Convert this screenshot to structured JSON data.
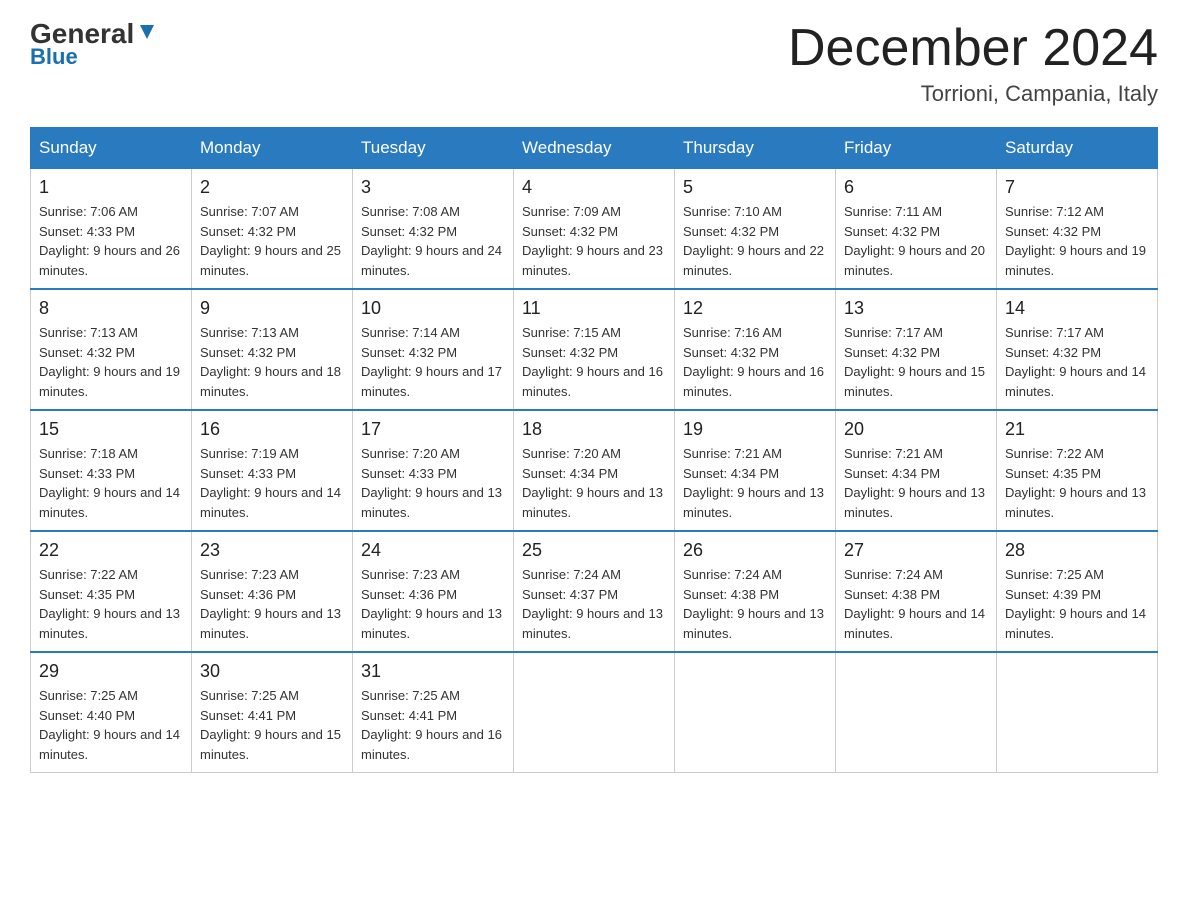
{
  "header": {
    "logo_general": "General",
    "logo_blue": "Blue",
    "month_year": "December 2024",
    "location": "Torrioni, Campania, Italy"
  },
  "days_of_week": [
    "Sunday",
    "Monday",
    "Tuesday",
    "Wednesday",
    "Thursday",
    "Friday",
    "Saturday"
  ],
  "weeks": [
    [
      {
        "day": "1",
        "sunrise": "7:06 AM",
        "sunset": "4:33 PM",
        "daylight": "9 hours and 26 minutes."
      },
      {
        "day": "2",
        "sunrise": "7:07 AM",
        "sunset": "4:32 PM",
        "daylight": "9 hours and 25 minutes."
      },
      {
        "day": "3",
        "sunrise": "7:08 AM",
        "sunset": "4:32 PM",
        "daylight": "9 hours and 24 minutes."
      },
      {
        "day": "4",
        "sunrise": "7:09 AM",
        "sunset": "4:32 PM",
        "daylight": "9 hours and 23 minutes."
      },
      {
        "day": "5",
        "sunrise": "7:10 AM",
        "sunset": "4:32 PM",
        "daylight": "9 hours and 22 minutes."
      },
      {
        "day": "6",
        "sunrise": "7:11 AM",
        "sunset": "4:32 PM",
        "daylight": "9 hours and 20 minutes."
      },
      {
        "day": "7",
        "sunrise": "7:12 AM",
        "sunset": "4:32 PM",
        "daylight": "9 hours and 19 minutes."
      }
    ],
    [
      {
        "day": "8",
        "sunrise": "7:13 AM",
        "sunset": "4:32 PM",
        "daylight": "9 hours and 19 minutes."
      },
      {
        "day": "9",
        "sunrise": "7:13 AM",
        "sunset": "4:32 PM",
        "daylight": "9 hours and 18 minutes."
      },
      {
        "day": "10",
        "sunrise": "7:14 AM",
        "sunset": "4:32 PM",
        "daylight": "9 hours and 17 minutes."
      },
      {
        "day": "11",
        "sunrise": "7:15 AM",
        "sunset": "4:32 PM",
        "daylight": "9 hours and 16 minutes."
      },
      {
        "day": "12",
        "sunrise": "7:16 AM",
        "sunset": "4:32 PM",
        "daylight": "9 hours and 16 minutes."
      },
      {
        "day": "13",
        "sunrise": "7:17 AM",
        "sunset": "4:32 PM",
        "daylight": "9 hours and 15 minutes."
      },
      {
        "day": "14",
        "sunrise": "7:17 AM",
        "sunset": "4:32 PM",
        "daylight": "9 hours and 14 minutes."
      }
    ],
    [
      {
        "day": "15",
        "sunrise": "7:18 AM",
        "sunset": "4:33 PM",
        "daylight": "9 hours and 14 minutes."
      },
      {
        "day": "16",
        "sunrise": "7:19 AM",
        "sunset": "4:33 PM",
        "daylight": "9 hours and 14 minutes."
      },
      {
        "day": "17",
        "sunrise": "7:20 AM",
        "sunset": "4:33 PM",
        "daylight": "9 hours and 13 minutes."
      },
      {
        "day": "18",
        "sunrise": "7:20 AM",
        "sunset": "4:34 PM",
        "daylight": "9 hours and 13 minutes."
      },
      {
        "day": "19",
        "sunrise": "7:21 AM",
        "sunset": "4:34 PM",
        "daylight": "9 hours and 13 minutes."
      },
      {
        "day": "20",
        "sunrise": "7:21 AM",
        "sunset": "4:34 PM",
        "daylight": "9 hours and 13 minutes."
      },
      {
        "day": "21",
        "sunrise": "7:22 AM",
        "sunset": "4:35 PM",
        "daylight": "9 hours and 13 minutes."
      }
    ],
    [
      {
        "day": "22",
        "sunrise": "7:22 AM",
        "sunset": "4:35 PM",
        "daylight": "9 hours and 13 minutes."
      },
      {
        "day": "23",
        "sunrise": "7:23 AM",
        "sunset": "4:36 PM",
        "daylight": "9 hours and 13 minutes."
      },
      {
        "day": "24",
        "sunrise": "7:23 AM",
        "sunset": "4:36 PM",
        "daylight": "9 hours and 13 minutes."
      },
      {
        "day": "25",
        "sunrise": "7:24 AM",
        "sunset": "4:37 PM",
        "daylight": "9 hours and 13 minutes."
      },
      {
        "day": "26",
        "sunrise": "7:24 AM",
        "sunset": "4:38 PM",
        "daylight": "9 hours and 13 minutes."
      },
      {
        "day": "27",
        "sunrise": "7:24 AM",
        "sunset": "4:38 PM",
        "daylight": "9 hours and 14 minutes."
      },
      {
        "day": "28",
        "sunrise": "7:25 AM",
        "sunset": "4:39 PM",
        "daylight": "9 hours and 14 minutes."
      }
    ],
    [
      {
        "day": "29",
        "sunrise": "7:25 AM",
        "sunset": "4:40 PM",
        "daylight": "9 hours and 14 minutes."
      },
      {
        "day": "30",
        "sunrise": "7:25 AM",
        "sunset": "4:41 PM",
        "daylight": "9 hours and 15 minutes."
      },
      {
        "day": "31",
        "sunrise": "7:25 AM",
        "sunset": "4:41 PM",
        "daylight": "9 hours and 16 minutes."
      },
      null,
      null,
      null,
      null
    ]
  ]
}
